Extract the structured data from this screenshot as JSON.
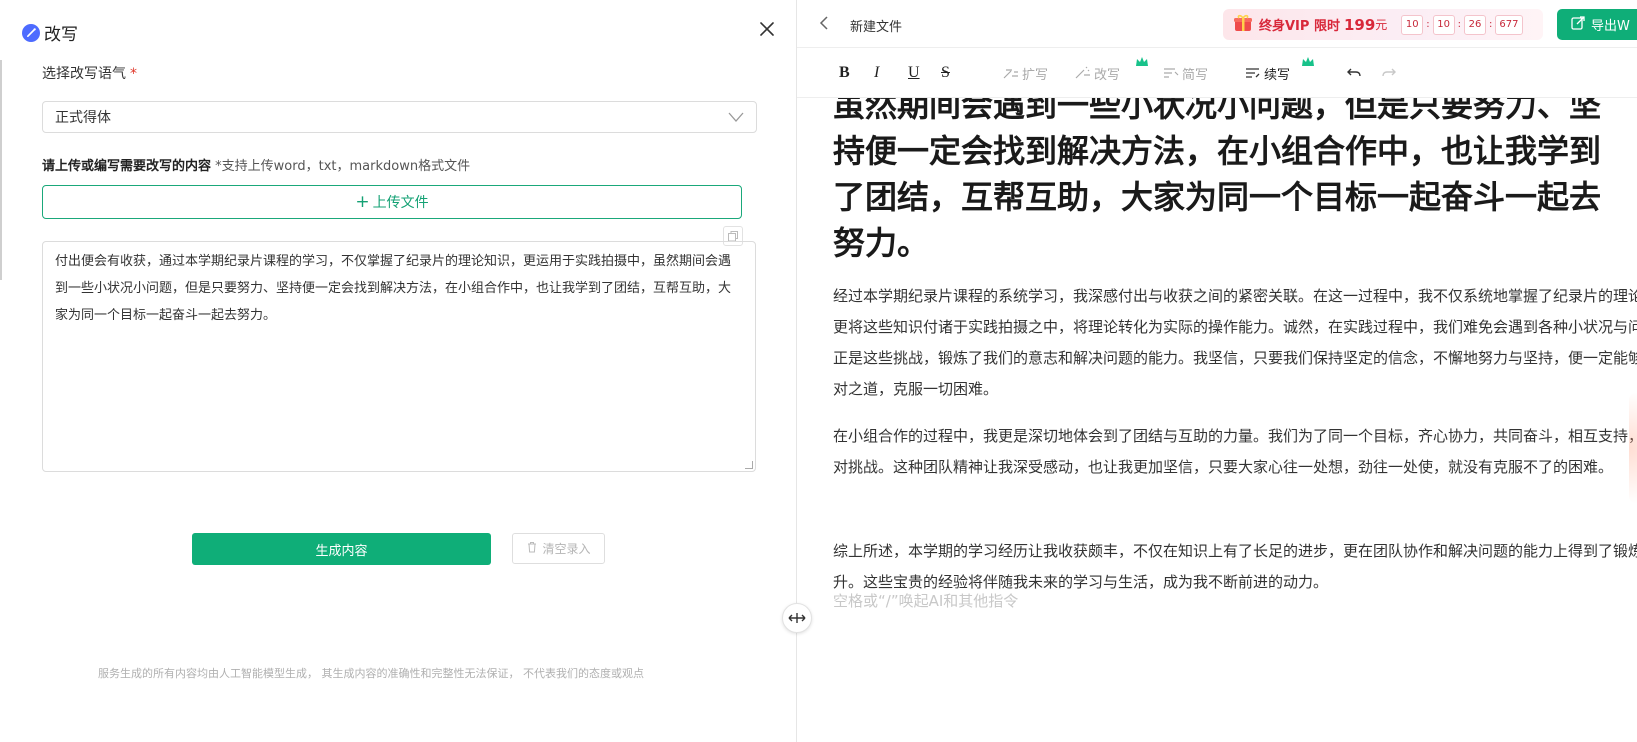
{
  "left_panel": {
    "title": "改写",
    "tone": {
      "label": "选择改写语气",
      "required_mark": "*",
      "selected": "正式得体"
    },
    "upload": {
      "label": "请上传或编写需要改写的内容",
      "hint": "*支持上传word，txt，markdown格式文件",
      "button_plus": "+",
      "button_label": "上传文件"
    },
    "input_text": "付出便会有收获，通过本学期纪录片课程的学习，不仅掌握了纪录片的理论知识，更运用于实践拍摄中，虽然期间会遇到一些小状况小问题，但是只要努力、坚持便一定会找到解决方法，在小组合作中，也让我学到了团结，互帮互助，大家为同一个目标一起奋斗一起去努力。",
    "generate_label": "生成内容",
    "clear_label": "清空录入",
    "disclaimer": "服务生成的所有内容均由人工智能模型生成， 其生成内容的准确性和完整性无法保证， 不代表我们的态度或观点"
  },
  "editor": {
    "doc_name": "新建文件",
    "vip": {
      "text": "终身VIP 限时",
      "price": "199",
      "unit": "元",
      "countdown": [
        "10",
        "10",
        "26",
        "677"
      ]
    },
    "export_label": "导出W",
    "toolbar": {
      "bold": "B",
      "italic": "I",
      "underline": "U",
      "strike": "S",
      "expand": "扩写",
      "rewrite": "改写",
      "simplify": "简写",
      "continue": "续写"
    },
    "heading": "虽然期间会遇到一些小状况小问题，但是只要努力、坚持便一定会找到解决方法，在小组合作中，也让我学到了团结，互帮互助，大家为同一个目标一起奋斗一起去努力。",
    "paragraphs": [
      "经过本学期纪录片课程的系统学习，我深感付出与收获之间的紧密关联。在这一过程中，我不仅系统地掌握了纪录片的理论知识，更将这些知识付诸于实践拍摄之中，将理论转化为实际的操作能力。诚然，在实践过程中，我们难免会遇到各种小状况与问题，但正是这些挑战，锻炼了我们的意志和解决问题的能力。我坚信，只要我们保持坚定的信念，不懈地努力与坚持，便一定能够找到应对之道，克服一切困难。",
      "在小组合作的过程中，我更是深切地体会到了团结与互助的力量。我们为了同一个目标，齐心协力，共同奋斗，相互支持，共同面对挑战。这种团队精神让我深受感动，也让我更加坚信，只要大家心往一处想，劲往一处使，就没有克服不了的困难。",
      "综上所述，本学期的学习经历让我收获颇丰，不仅在知识上有了长足的进步，更在团队协作和解决问题的能力上得到了锻炼和提升。这些宝贵的经验将伴随我未来的学习与生活，成为我不断前进的动力。"
    ],
    "placeholder": "空格或“/”唤起AI和其他指令"
  },
  "colors": {
    "brand_green": "#0fae78",
    "vip_red": "#d8283a",
    "title_icon_blue": "#4d6bff"
  },
  "icons": [
    "magic-pen-icon",
    "close-icon",
    "chevron-down-icon",
    "copy-icon",
    "trash-icon",
    "resize-handle-icon",
    "back-chevron-icon",
    "gift-icon",
    "export-icon",
    "crown-icon",
    "undo-icon",
    "redo-icon"
  ]
}
